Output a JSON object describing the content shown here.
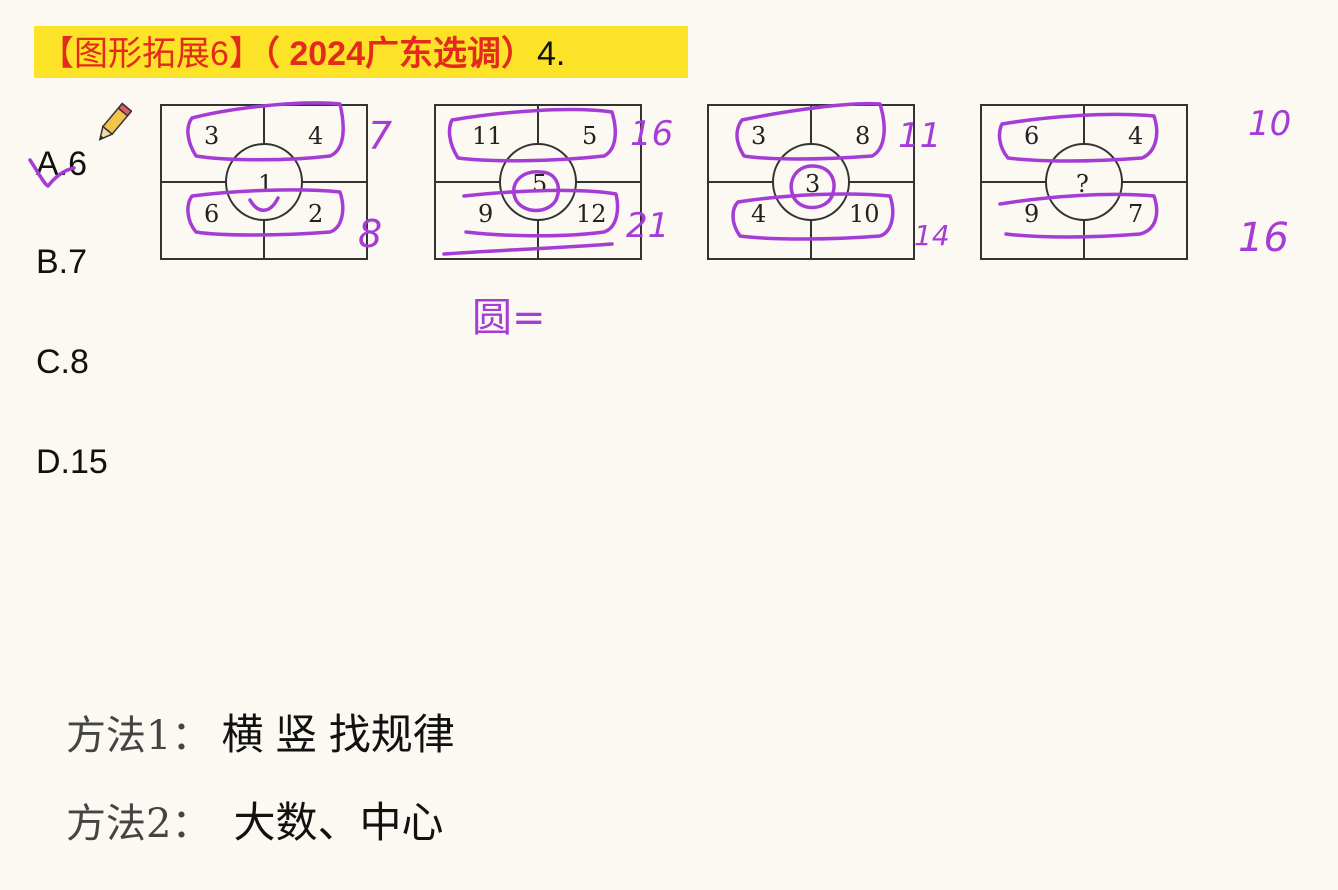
{
  "header": {
    "topic": "【图形拓展6】",
    "source": "（ 2024广东选调）",
    "question_no": "4."
  },
  "options": [
    {
      "label": "A.6"
    },
    {
      "label": "B.7"
    },
    {
      "label": "C.8"
    },
    {
      "label": "D.15"
    }
  ],
  "figures": [
    {
      "tl": "3",
      "tr": "4",
      "center": "1",
      "bl": "6",
      "br": "2"
    },
    {
      "tl": "11",
      "tr": "5",
      "center": "5",
      "bl": "9",
      "br": "12"
    },
    {
      "tl": "3",
      "tr": "8",
      "center": "3",
      "bl": "4",
      "br": "10"
    },
    {
      "tl": "6",
      "tr": "4",
      "center": "?",
      "bl": "9",
      "br": "7"
    }
  ],
  "annotations": {
    "row_sums": [
      {
        "top": "7",
        "bottom": "8"
      },
      {
        "top": "16",
        "bottom": "21"
      },
      {
        "top": "11",
        "bottom": "14"
      },
      {
        "top": "10",
        "bottom": "16"
      }
    ],
    "circle_note": "圆=",
    "ink_color": "#a63cd6"
  },
  "methods": [
    {
      "label": "方法1：",
      "value": "横 竖 找规律"
    },
    {
      "label": "方法2：",
      "value": "大数、中心"
    }
  ],
  "colors": {
    "highlight": "#fde327",
    "title_red": "#e42a1c",
    "background": "#fbf9f2"
  }
}
